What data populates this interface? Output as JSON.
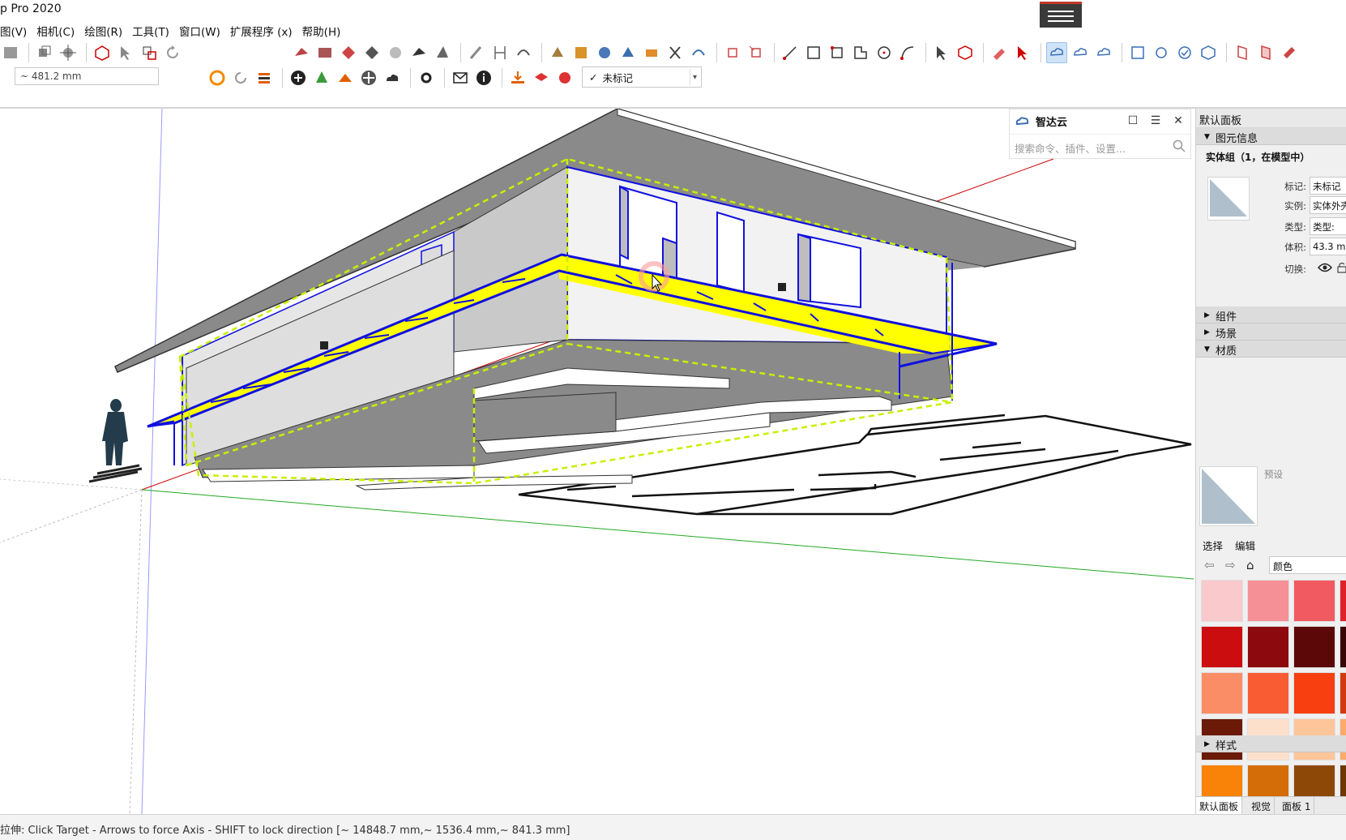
{
  "app": {
    "title": "p Pro 2020"
  },
  "menu": [
    "图(V)",
    "相机(C)",
    "绘图(R)",
    "工具(T)",
    "窗口(W)",
    "扩展程序 (x)",
    "帮助(H)"
  ],
  "measurements": {
    "value": "~ 481.2 mm"
  },
  "tag_select": {
    "checkmark": "✓",
    "value": "未标记"
  },
  "search_panel": {
    "title": "智达云",
    "placeholder": "搜索命令、插件、设置...",
    "restore_glyph": "☐",
    "menu_glyph": "☰",
    "close_glyph": "✕"
  },
  "tray": {
    "title": "默认面板",
    "entity_info": {
      "section": "图元信息",
      "heading": "实体组（1，在模型中）",
      "fields": [
        {
          "label": "标记:",
          "value": "未标记"
        },
        {
          "label": "实例:",
          "value": "实体外壳"
        },
        {
          "label": "类型:",
          "value": "类型:"
        },
        {
          "label": "体积:",
          "value": "43.3 m"
        },
        {
          "label": "切换:",
          "value": ""
        }
      ]
    },
    "sections": {
      "components": "组件",
      "scenes": "场景",
      "materials": "材质",
      "styles": "样式"
    },
    "materials": {
      "name": "预设",
      "tabs": {
        "select": "选择",
        "edit": "编辑"
      },
      "collection": "颜色",
      "swatches": [
        "#f9c9cc",
        "#f59096",
        "#f15a60",
        "#e02028",
        "#cc0d10",
        "#8c0a0d",
        "#5c0708",
        "#3a0506",
        "#fb8d66",
        "#f95b33",
        "#f73f10",
        "#d13a0c",
        "#6a1a07",
        "#fde0cc",
        "#fdc59a",
        "#fcab6a",
        "#f98309",
        "#d46c08",
        "#8d4807",
        "#6e3805",
        "#fde39d",
        "#fdd15d",
        "#fdc426",
        "#e8ac10"
      ]
    },
    "bottom_tabs": [
      "默认面板",
      "视觉",
      "面板 1"
    ]
  },
  "status_bar": {
    "text": "拉伸: Click Target - Arrows to force Axis - SHIFT to lock direction  [~ 14848.7 mm,~ 1536.4 mm,~ 841.3 mm]"
  },
  "colors": {
    "selection_blue": "#1010e0",
    "highlight_yellow": "#ffff00",
    "face_gray": "#808080",
    "dashed_green": "#c8f000"
  }
}
